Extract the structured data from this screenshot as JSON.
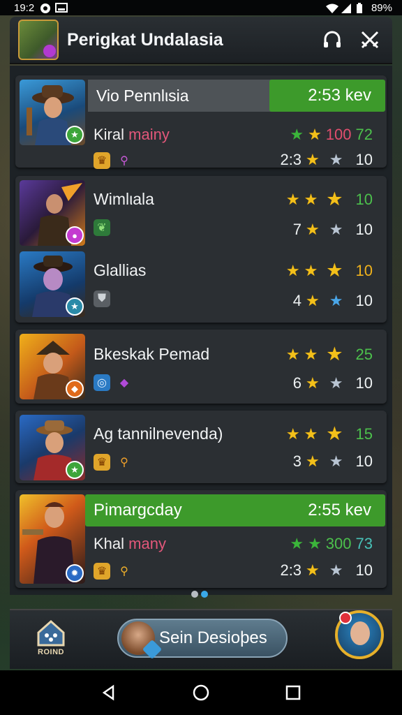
{
  "status_bar": {
    "time": "19:2",
    "battery": "89%"
  },
  "header": {
    "title": "Perigkat Undalasia"
  },
  "players": [
    {
      "name": "Vio Pennlιsia",
      "timer": "2:53 kev",
      "subname_prefix": "Kiral",
      "subname_highlight": "mainy",
      "stat1": "100",
      "stat2": "72",
      "stat3": "2:3",
      "stat4": "10"
    },
    {
      "name": "Wimlιala",
      "score": "10",
      "stat_a": "7",
      "stat_b": "10"
    },
    {
      "name": "Glallias",
      "score": "10",
      "stat_a": "4",
      "stat_b": "10"
    },
    {
      "name": "Bkeskak Pemad",
      "score": "25",
      "stat_a": "6",
      "stat_b": "10"
    },
    {
      "name": "Ag tannilnevenda)",
      "score": "15",
      "stat_a": "3",
      "stat_b": "10"
    },
    {
      "name": "Pimargcday",
      "timer": "2:55 kev",
      "subname_prefix": "Khal",
      "subname_highlight": "many",
      "stat1": "300",
      "stat2": "73",
      "stat3": "2:3",
      "stat4": "10"
    }
  ],
  "bottom_bar": {
    "home_label": "ROIND",
    "main_button_label": "Sein Desioþes"
  },
  "colors": {
    "accent_green": "#3d9a2b",
    "gold_star": "#f3c01a",
    "highlight_pink": "#e2577a"
  }
}
